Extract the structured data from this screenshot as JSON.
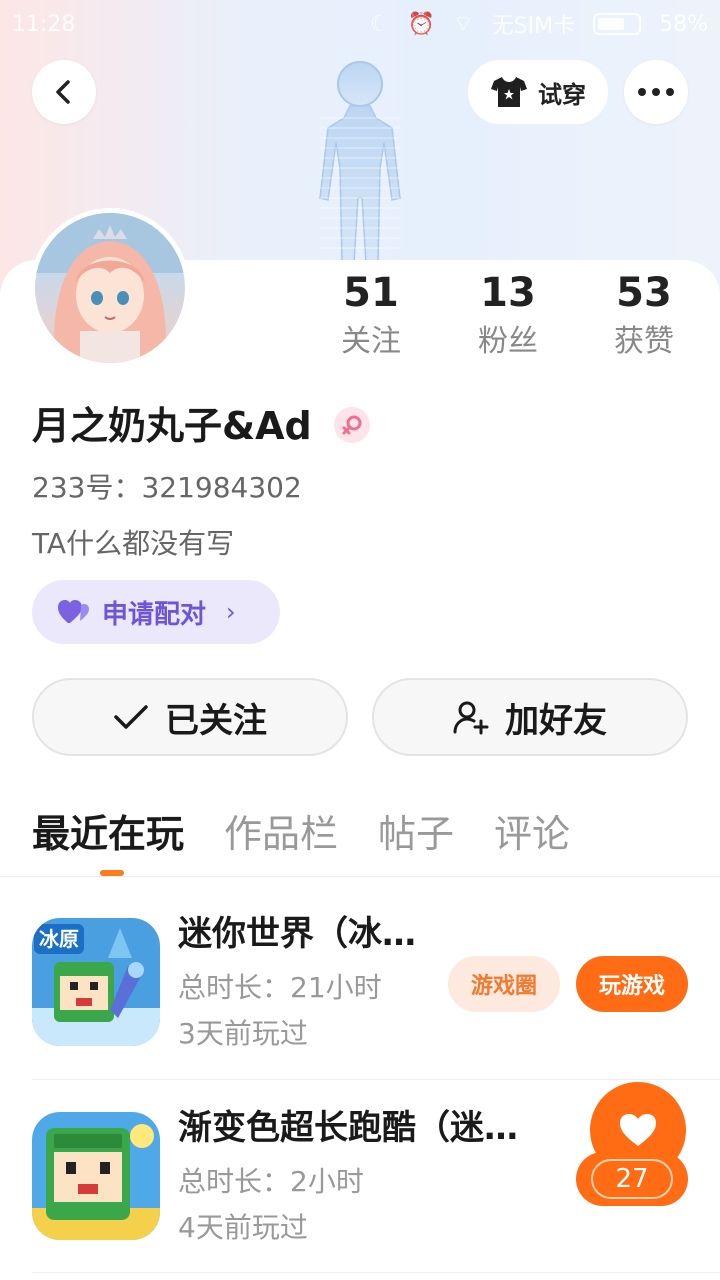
{
  "status_bar": {
    "time": "11:28",
    "carrier": "无SIM卡",
    "battery": "58%"
  },
  "header": {
    "tryon_label": "试穿"
  },
  "profile": {
    "username": "月之奶丸子&Ad",
    "account_id": "233号：321984302",
    "bio": "TA什么都没有写",
    "pair_label": "申请配对"
  },
  "stats": [
    {
      "value": "51",
      "label": "关注"
    },
    {
      "value": "13",
      "label": "粉丝"
    },
    {
      "value": "53",
      "label": "获赞"
    }
  ],
  "actions": {
    "followed_label": "已关注",
    "add_friend_label": "加好友"
  },
  "tabs": [
    {
      "label": "最近在玩",
      "active": true
    },
    {
      "label": "作品栏",
      "active": false
    },
    {
      "label": "帖子",
      "active": false
    },
    {
      "label": "评论",
      "active": false
    }
  ],
  "games": [
    {
      "name": "迷你世界（冰…",
      "duration": "总时长：21小时",
      "last_played": "3天前玩过",
      "icon_text": "冰原",
      "circle_label": "游戏圈",
      "play_label": "玩游戏"
    },
    {
      "name": "渐变色超长跑酷（迷…",
      "duration": "总时长：2小时",
      "last_played": "4天前玩过"
    }
  ],
  "like": {
    "count": "27"
  },
  "colors": {
    "accent": "#ff6c13",
    "pair_purple": "#6d55d6"
  }
}
